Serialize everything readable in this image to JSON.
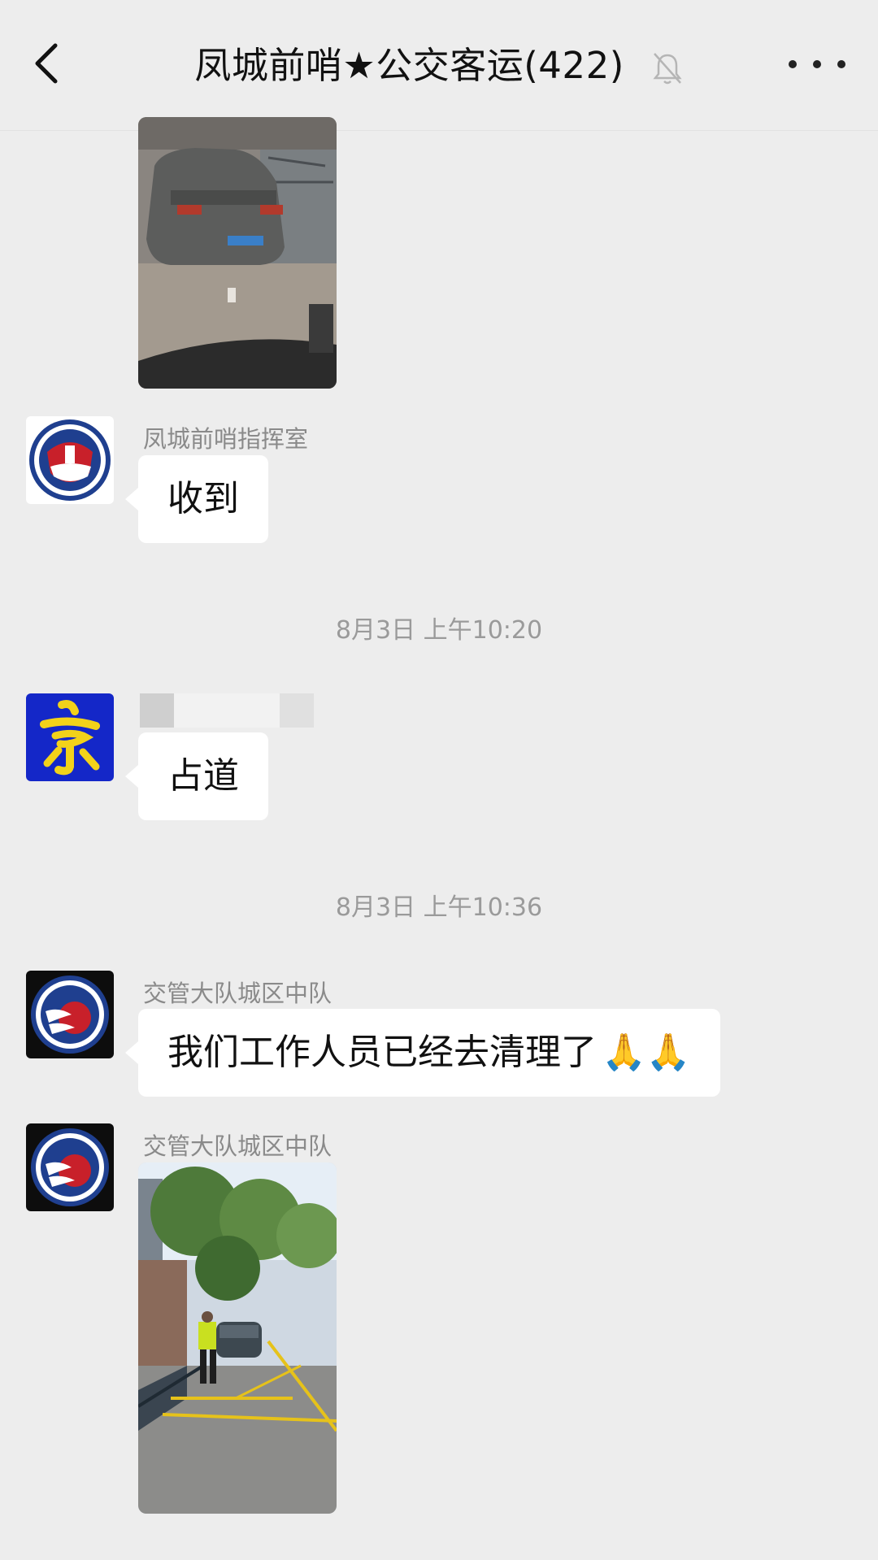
{
  "header": {
    "title": "凤城前哨★公交客运(422)",
    "back_icon": "chevron-left-icon",
    "muted_icon": "bell-off-icon",
    "more_icon": "more-icon"
  },
  "messages": [
    {
      "type": "image",
      "description": "car photo"
    },
    {
      "sender": "凤城前哨指挥室",
      "text": "收到",
      "avatar": "police-badge-avatar"
    },
    {
      "timestamp": "8月3日 上午10:20"
    },
    {
      "sender": "",
      "text": "占道",
      "avatar": "yellow-glyph-avatar"
    },
    {
      "timestamp": "8月3日 上午10:36"
    },
    {
      "sender": "交管大队城区中队",
      "text": "我们工作人员已经去清理了",
      "emoji": "🙏🙏",
      "avatar": "traffic-police-avatar"
    },
    {
      "sender": "交管大队城区中队",
      "type": "image",
      "avatar": "traffic-police-avatar"
    }
  ],
  "colors": {
    "background": "#ededed",
    "bubble": "#ffffff",
    "timestamp": "#9a9a9a",
    "sender": "#8a8a8a"
  }
}
